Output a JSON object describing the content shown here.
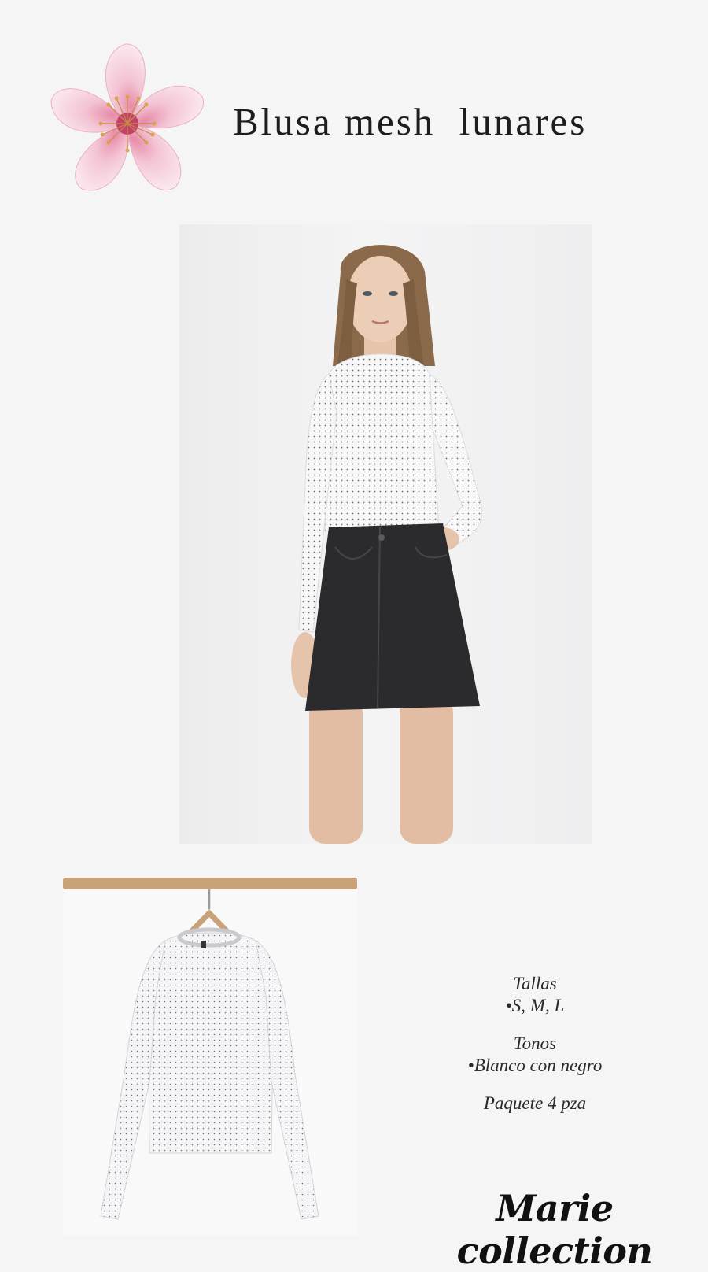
{
  "title": "Blusa mesh  lunares",
  "info": {
    "sizes_label": "Tallas",
    "sizes_value": "•S, M, L",
    "tones_label": "Tonos",
    "tones_value": "•Blanco con negro",
    "package": "Paquete 4 pza"
  },
  "brand": "Marie collection",
  "colors": {
    "background": "#f5f5f6",
    "flower_pink": "#f2bfd0",
    "skirt": "#2b2b2d",
    "blouse": "#ffffff"
  },
  "images": {
    "flower": "cherry-blossom-icon",
    "model": "model-photo",
    "hanger": "hanger-blouse-photo"
  }
}
